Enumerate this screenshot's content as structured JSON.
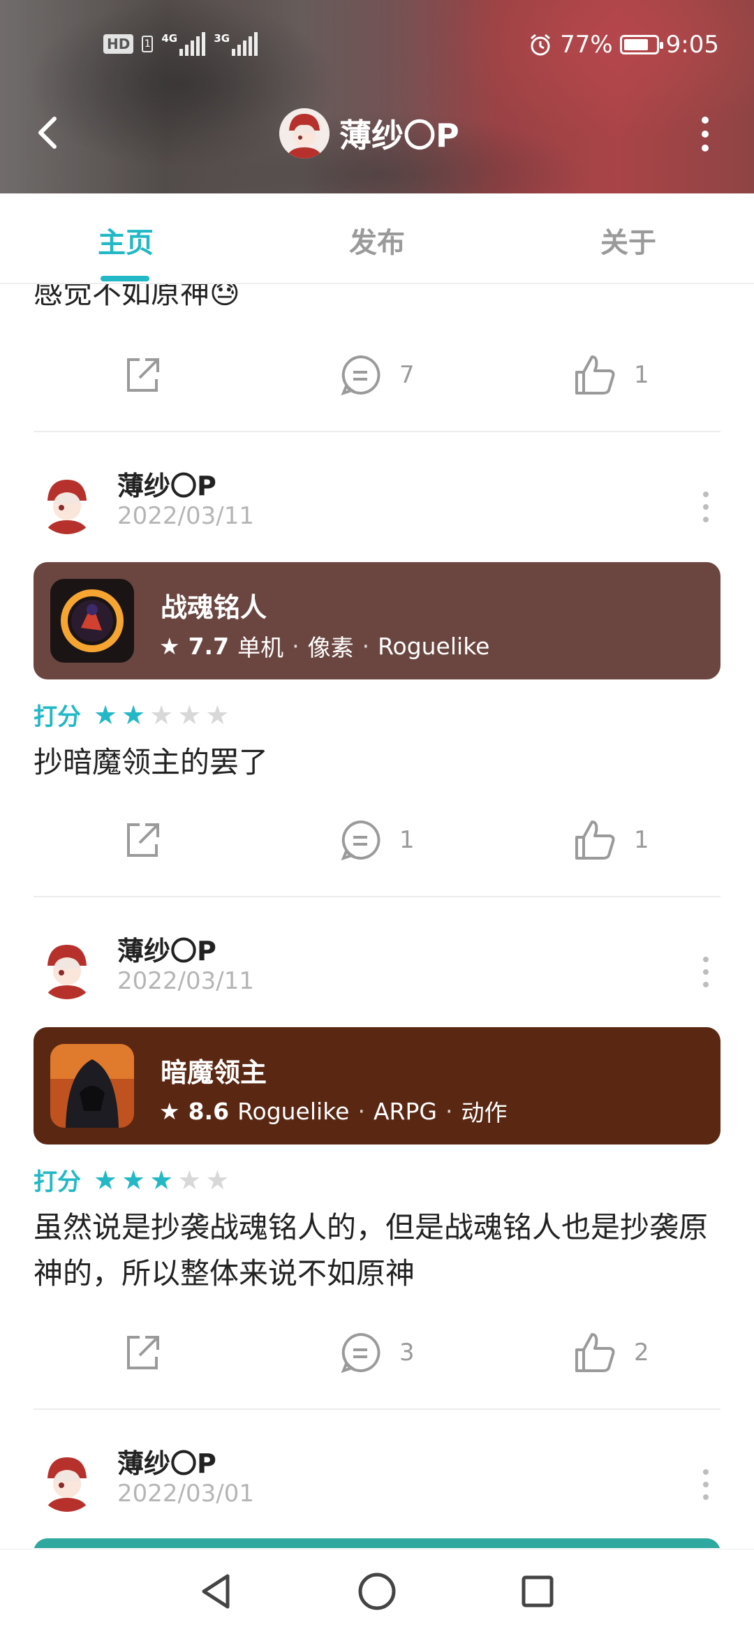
{
  "status_bar": {
    "left_badges": [
      "HD",
      "1"
    ],
    "signal1_net": "4G",
    "signal2_net": "3G",
    "battery_percent": "77%",
    "battery_level": 0.77,
    "time": "9:05"
  },
  "header": {
    "title": "薄纱〇P"
  },
  "tabs": [
    {
      "label": "主页",
      "active": true
    },
    {
      "label": "发布",
      "active": false
    },
    {
      "label": "关于",
      "active": false
    }
  ],
  "posts": [
    {
      "text": "感觉不如原神😓",
      "comments": "7",
      "likes": "1"
    },
    {
      "user": "薄纱〇P",
      "date": "2022/03/11",
      "game": {
        "name": "战魂铭人",
        "score": "7.7",
        "tags": [
          "单机",
          "像素",
          "Roguelike"
        ],
        "card_color": "#6b4640"
      },
      "rating_label": "打分",
      "rating": 2,
      "text": "抄暗魔领主的罢了",
      "comments": "1",
      "likes": "1"
    },
    {
      "user": "薄纱〇P",
      "date": "2022/03/11",
      "game": {
        "name": "暗魔领主",
        "score": "8.6",
        "tags": [
          "Roguelike",
          "ARPG",
          "动作"
        ],
        "card_color": "#5a2713"
      },
      "rating_label": "打分",
      "rating": 3,
      "text": "虽然说是抄袭战魂铭人的，但是战魂铭人也是抄袭原神的，所以整体来说不如原神",
      "comments": "3",
      "likes": "2"
    },
    {
      "user": "薄纱〇P",
      "date": "2022/03/01",
      "partial_card_color": "#2fa8a0"
    }
  ],
  "colors": {
    "accent": "#22b8c6",
    "star_off": "#d8d8d8",
    "muted": "#9a9a9a"
  },
  "icons": {
    "share": "share-icon",
    "comment": "comment-icon",
    "like": "thumbs-up-icon",
    "back": "back-arrow-icon",
    "more": "more-vertical-icon",
    "nav_back": "nav-back-triangle-icon",
    "nav_home": "nav-home-circle-icon",
    "nav_recent": "nav-recents-square-icon"
  }
}
